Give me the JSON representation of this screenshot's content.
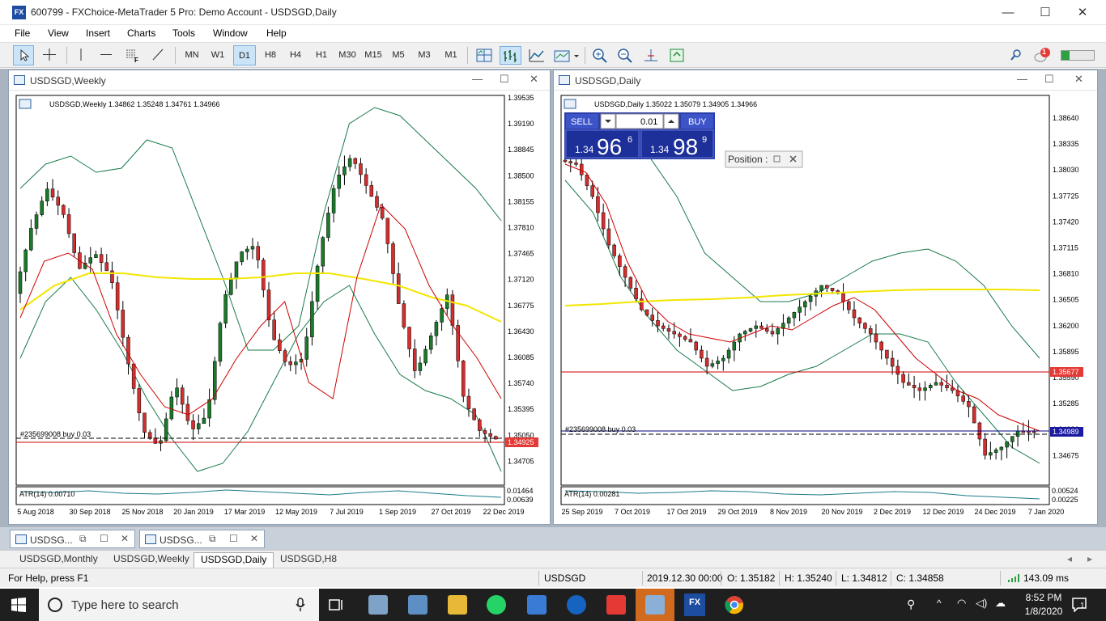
{
  "window": {
    "title": "600799 - FXChoice-MetaTrader 5 Pro: Demo Account - USDSGD,Daily",
    "app_icon": "FX",
    "minimize": "—",
    "maximize": "☐",
    "close": "✕"
  },
  "menu": [
    "File",
    "View",
    "Insert",
    "Charts",
    "Tools",
    "Window",
    "Help"
  ],
  "toolbar": {
    "timeframes": [
      "MN",
      "W1",
      "D1",
      "H8",
      "H4",
      "H1",
      "M30",
      "M15",
      "M5",
      "M3",
      "M1"
    ],
    "selected": "D1",
    "alert_count": "1",
    "colors": {
      "selected_bg": "#cce4f7"
    }
  },
  "weekly": {
    "window_title": "USDSGD,Weekly",
    "info": "USDSGD,Weekly  1.34862 1.35248 1.34761 1.34966",
    "prices": [
      "1.39535",
      "1.39190",
      "1.38845",
      "1.38500",
      "1.38155",
      "1.37810",
      "1.37465",
      "1.37120",
      "1.36775",
      "1.36430",
      "1.36085",
      "1.35740",
      "1.35395",
      "1.35050",
      "1.34705"
    ],
    "price_tag": "1.34925",
    "order_label": "#235699008 buy 0.03",
    "atr_label": "ATR(14) 0.00710",
    "atr_scale": [
      "0.01464",
      "0.00639"
    ],
    "dates": [
      "5 Aug 2018",
      "30 Sep 2018",
      "25 Nov 2018",
      "20 Jan 2019",
      "17 Mar 2019",
      "12 May 2019",
      "7 Jul 2019",
      "1 Sep 2019",
      "27 Oct 2019",
      "22 Dec 2019"
    ]
  },
  "daily": {
    "window_title": "USDSGD,Daily",
    "info": "USDSGD,Daily  1.35022 1.35079 1.34905 1.34966",
    "prices": [
      "1.38640",
      "1.38335",
      "1.38030",
      "1.37725",
      "1.37420",
      "1.37115",
      "1.36810",
      "1.36505",
      "1.36200",
      "1.35895",
      "1.35590",
      "1.35285",
      "1.34980",
      "1.34675"
    ],
    "price_tag_red": "1.35677",
    "price_tag_blue": "1.34989",
    "order_label": "#235699008 buy 0.03",
    "atr_label": "ATR(14) 0.00281",
    "atr_scale": [
      "0.00524",
      "0.00225"
    ],
    "dates": [
      "25 Sep 2019",
      "7 Oct 2019",
      "17 Oct 2019",
      "29 Oct 2019",
      "8 Nov 2019",
      "20 Nov 2019",
      "2 Dec 2019",
      "12 Dec 2019",
      "24 Dec 2019",
      "7 Jan 2020"
    ],
    "trade": {
      "sell": "SELL",
      "buy": "BUY",
      "lot": "0.01",
      "sell_prefix": "1.34",
      "sell_big": "96",
      "sell_sup": "6",
      "buy_prefix": "1.34",
      "buy_big": "98",
      "buy_sup": "9"
    },
    "position_label": "Position :"
  },
  "minimized": [
    {
      "title": "USDSG..."
    },
    {
      "title": "USDSG..."
    }
  ],
  "tabs": [
    "USDSGD,Monthly",
    "USDSGD,Weekly",
    "USDSGD,Daily",
    "USDSGD,H8"
  ],
  "active_tab": "USDSGD,Daily",
  "status": {
    "help": "For Help, press F1",
    "symbol": "USDSGD",
    "datetime": "2019.12.30 00:00",
    "open": "O: 1.35182",
    "high": "H: 1.35240",
    "low": "L: 1.34812",
    "close": "C: 1.34858",
    "ping": "143.09 ms"
  },
  "taskbar": {
    "search_placeholder": "Type here to search",
    "time": "8:52 PM",
    "date": "1/8/2020",
    "notifications": "1"
  }
}
